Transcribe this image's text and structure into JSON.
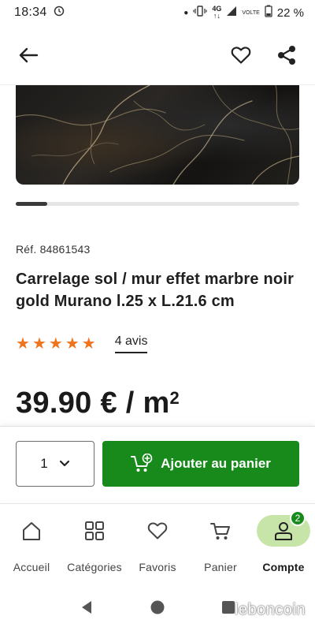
{
  "status_bar": {
    "time": "18:34",
    "network": "4G",
    "network_sub": "↑↓",
    "volte": "VOLTE",
    "battery": "22 %"
  },
  "header": {
    "back_icon": "arrow-left-icon",
    "favorite_icon": "heart-outline-icon",
    "share_icon": "share-icon"
  },
  "product": {
    "image_alt": "black gold marble tile",
    "carousel_progress": 0.11,
    "reference": "Réf. 84861543",
    "title": "Carrelage sol / mur effet marbre noir gold Murano l.25 x L.21.6 cm",
    "rating": 5,
    "reviews_label": "4 avis",
    "price": "39.90 € / m",
    "price_sup": "2",
    "star_color": "#f0731e"
  },
  "cart_bar": {
    "quantity": "1",
    "add_label": "Ajouter au panier",
    "add_color": "#178a1b"
  },
  "bottom_nav": {
    "items": [
      {
        "label": "Accueil",
        "icon": "home-icon"
      },
      {
        "label": "Catégories",
        "icon": "grid-icon"
      },
      {
        "label": "Favoris",
        "icon": "heart-icon"
      },
      {
        "label": "Panier",
        "icon": "cart-icon"
      },
      {
        "label": "Compte",
        "icon": "user-icon",
        "badge": "2",
        "active": true
      }
    ]
  },
  "watermark": "leboncoin"
}
